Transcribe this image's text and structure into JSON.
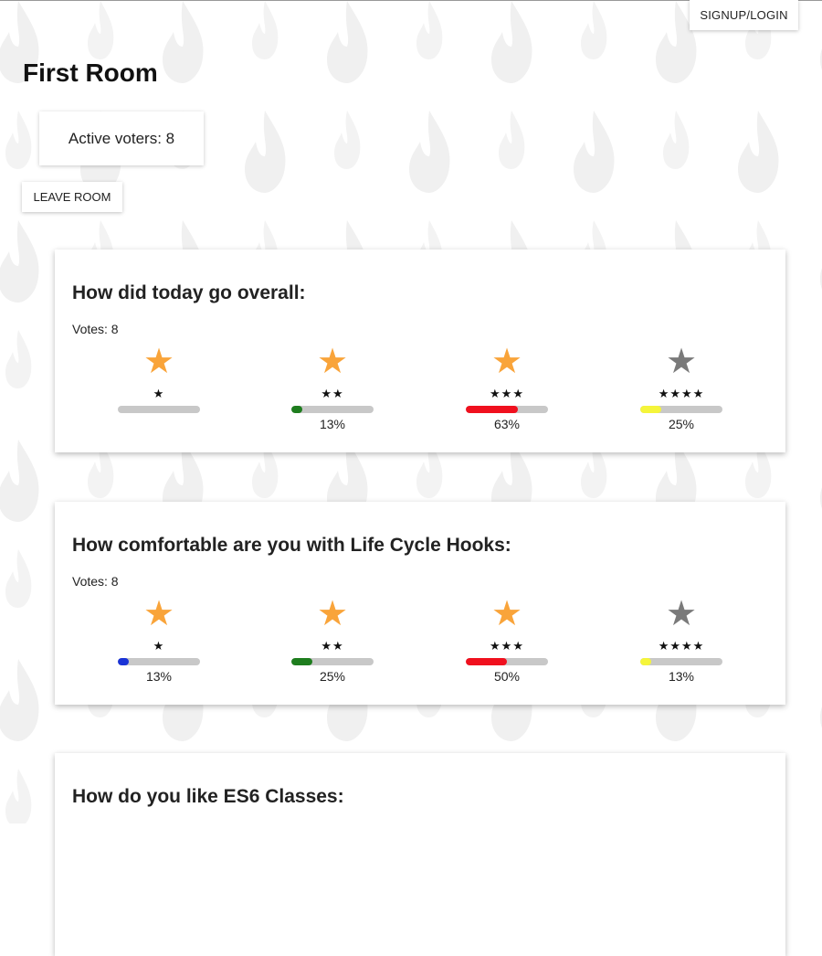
{
  "header": {
    "signup_label": "SIGNUP/LOGIN"
  },
  "room": {
    "title": "First Room",
    "active_voters_text": "Active voters: 8",
    "leave_label": "LEAVE ROOM"
  },
  "questions": [
    {
      "title": "How did today go overall:",
      "votes_text": "Votes: 8",
      "options": [
        {
          "stars": "★",
          "star_color": "#f9a43a",
          "bar_color": "#1a33d6",
          "fraction": 0.0,
          "percent_text": ""
        },
        {
          "stars": "★★",
          "star_color": "#f9a43a",
          "bar_color": "#1e7d1e",
          "fraction": 0.13,
          "percent_text": "13%"
        },
        {
          "stars": "★★★",
          "star_color": "#f9a43a",
          "bar_color": "#f0101e",
          "fraction": 0.63,
          "percent_text": "63%"
        },
        {
          "stars": "★★★★",
          "star_color": "#7a7a7a",
          "bar_color": "#f5f53a",
          "fraction": 0.25,
          "percent_text": "25%"
        }
      ]
    },
    {
      "title": "How comfortable are you with Life Cycle Hooks:",
      "votes_text": "Votes: 8",
      "options": [
        {
          "stars": "★",
          "star_color": "#f9a43a",
          "bar_color": "#1a33d6",
          "fraction": 0.13,
          "percent_text": "13%"
        },
        {
          "stars": "★★",
          "star_color": "#f9a43a",
          "bar_color": "#1e7d1e",
          "fraction": 0.25,
          "percent_text": "25%"
        },
        {
          "stars": "★★★",
          "star_color": "#f9a43a",
          "bar_color": "#f0101e",
          "fraction": 0.5,
          "percent_text": "50%"
        },
        {
          "stars": "★★★★",
          "star_color": "#7a7a7a",
          "bar_color": "#f5f53a",
          "fraction": 0.13,
          "percent_text": "13%"
        }
      ]
    },
    {
      "title": "How do you like ES6 Classes:"
    }
  ],
  "icons": {
    "background": "flame-icon",
    "rating": "star-icon"
  }
}
